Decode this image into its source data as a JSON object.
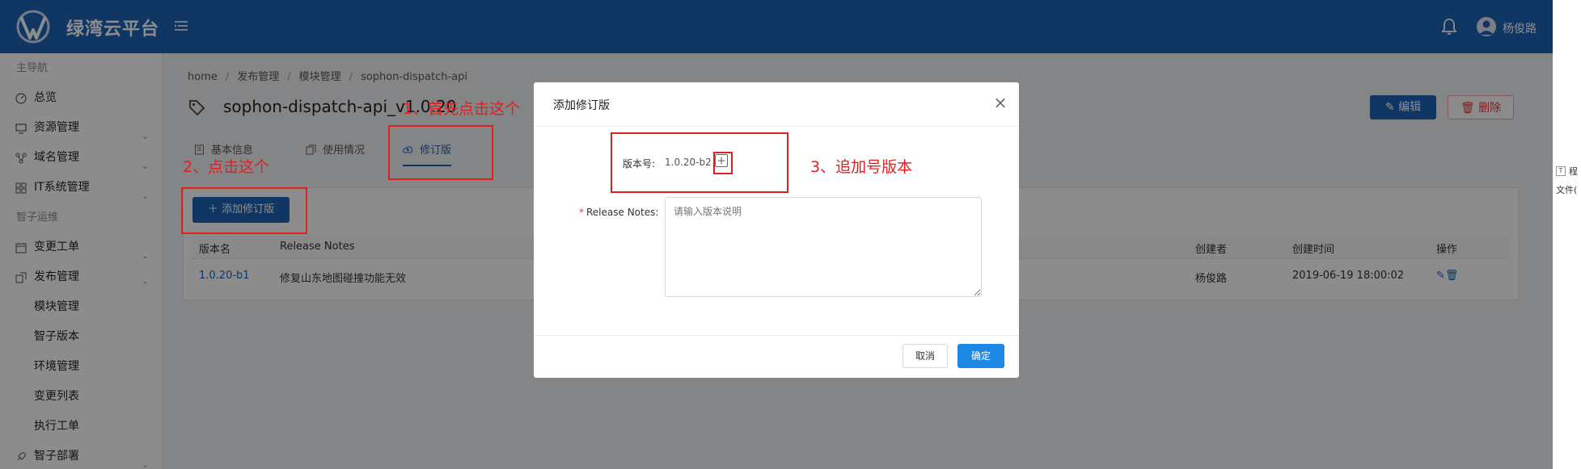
{
  "header": {
    "logo_text": "绿湾云平台",
    "username": "杨俊路",
    "icons": [
      "logo-mark",
      "menu-toggle-icon",
      "bell-icon",
      "user-avatar-icon"
    ]
  },
  "sidebar": {
    "group_main": "主导航",
    "overview": "总览",
    "resource": "资源管理",
    "domain": "域名管理",
    "it_system": "IT系统管理",
    "group_ops": "智子运维",
    "change_ticket": "变更工单",
    "release": "发布管理",
    "release_sub": [
      "模块管理",
      "智子版本",
      "环境管理",
      "变更列表",
      "执行工单"
    ],
    "deploy": "智子部署"
  },
  "breadcrumb": [
    "home",
    "发布管理",
    "模块管理",
    "sophon-dispatch-api"
  ],
  "page": {
    "title": "sophon-dispatch-api_v1.0.20",
    "edit_label": "编辑",
    "delete_label": "删除"
  },
  "tabs": [
    "基本信息",
    "使用情况",
    "修订版"
  ],
  "revision": {
    "add_button": "添加修订版",
    "columns": [
      "版本名",
      "Release Notes",
      "创建者",
      "创建时间",
      "操作"
    ],
    "rows": [
      {
        "version": "1.0.20-b1",
        "notes": "修复山东地图碰撞功能无效",
        "creator": "杨俊路",
        "created": "2019-06-19 18:00:02"
      }
    ]
  },
  "modal": {
    "title": "添加修订版",
    "version_label": "版本号:",
    "version_value": "1.0.20-b2",
    "notes_label": "Release Notes:",
    "notes_placeholder": "请输入版本说明",
    "cancel": "取消",
    "ok": "确定"
  },
  "annotations": {
    "step1": "1、首先点击这个",
    "step2": "2、点击这个",
    "step3": "3、追加号版本"
  },
  "right_strip": {
    "item_a": "程",
    "item_b": "文件("
  },
  "colors": {
    "header": "#1e64b4",
    "primary": "#1e88e5",
    "annotation": "#e21f1f"
  }
}
